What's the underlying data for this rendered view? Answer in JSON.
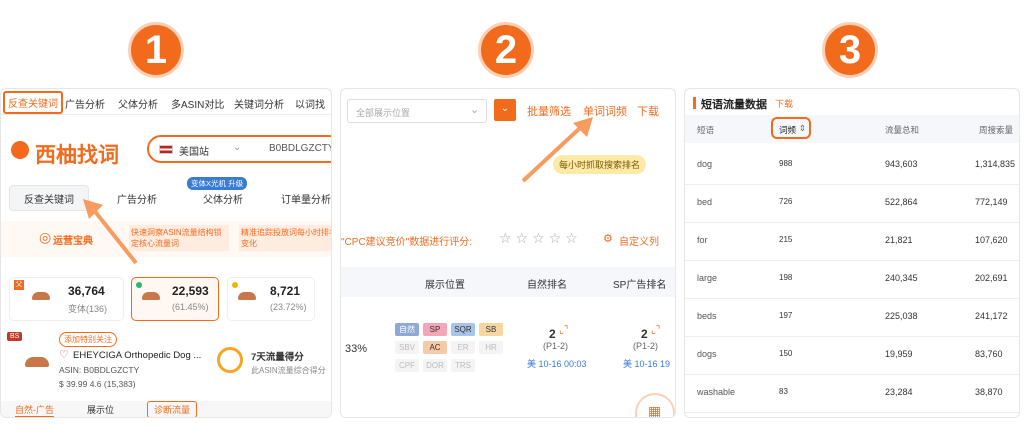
{
  "badges": [
    "1",
    "2",
    "3"
  ],
  "colors": {
    "accent": "#f26b1d"
  },
  "p1": {
    "nav": [
      "反查关键词",
      "广告分析",
      "父体分析",
      "多ASIN对比",
      "关键词分析",
      "以词找"
    ],
    "logo": "西柚找词",
    "site": "美国站",
    "asin_input": "B0BDLGZCTY",
    "tabs": [
      "反查关键词",
      "广告分析",
      "父体分析",
      "订单量分析"
    ],
    "tab_badge": "变体X光机 升级",
    "banner_title": "运营宝典",
    "banner_text1": "快速洞察ASIN流量结构锁定核心流量词",
    "banner_text2": "精准追踪投放词每小时排名变化",
    "cards": [
      {
        "value": "36,764",
        "sub": "变体(136)"
      },
      {
        "value": "22,593",
        "sub": "(61.45%)"
      },
      {
        "value": "8,721",
        "sub": "(23.72%)"
      }
    ],
    "bs": "BS",
    "follow": "添加特别关注",
    "product": "EHEYCIGA Orthopedic Dog ...",
    "asin_line": "ASIN: B0BDLGZCTY",
    "price": "$ 39.99 4.6 (15,383)",
    "score_title": "7天流量得分",
    "score_sub": "此ASIN流量综合得分",
    "bottom_tabs": [
      "自然-广告",
      "展示位",
      "诊断流量"
    ]
  },
  "p2": {
    "select_placeholder": "全部展示位置",
    "actions": [
      "批量筛选",
      "单词词频",
      "下载"
    ],
    "hourly": "每小时抓取搜索排名",
    "cpc_text": "\"CPC建议竞价\"数据进行评分:",
    "stars": "☆☆☆☆☆",
    "custom": "自定义列",
    "headers": [
      "展示位置",
      "自然排名",
      "SP广告排名"
    ],
    "pct": "33%",
    "chips": [
      "自然",
      "SP",
      "SQR",
      "SB",
      "SBV",
      "AC",
      "ER",
      "HR",
      "CPF",
      "DOR",
      "TRS"
    ],
    "rank1": "2",
    "rank1_sub": "(P1-2)",
    "rank1_time": "美 10-16 00:03",
    "rank2": "2",
    "rank2_sub": "(P1-2)",
    "rank2_time": "美 10-16 19"
  },
  "p3": {
    "title": "短语流量数据",
    "download": "下载",
    "headers": [
      "短语",
      "词频",
      "流量总和",
      "周搜索量"
    ],
    "rows": [
      {
        "phrase": "dog",
        "freq": "988",
        "total": "943,603",
        "weekly": "1,314,835"
      },
      {
        "phrase": "bed",
        "freq": "726",
        "total": "522,864",
        "weekly": "772,149"
      },
      {
        "phrase": "for",
        "freq": "215",
        "total": "21,821",
        "weekly": "107,620"
      },
      {
        "phrase": "large",
        "freq": "198",
        "total": "240,345",
        "weekly": "202,691"
      },
      {
        "phrase": "beds",
        "freq": "197",
        "total": "225,038",
        "weekly": "241,172"
      },
      {
        "phrase": "dogs",
        "freq": "150",
        "total": "19,959",
        "weekly": "83,760"
      },
      {
        "phrase": "washable",
        "freq": "83",
        "total": "23,284",
        "weekly": "38,870"
      }
    ]
  }
}
